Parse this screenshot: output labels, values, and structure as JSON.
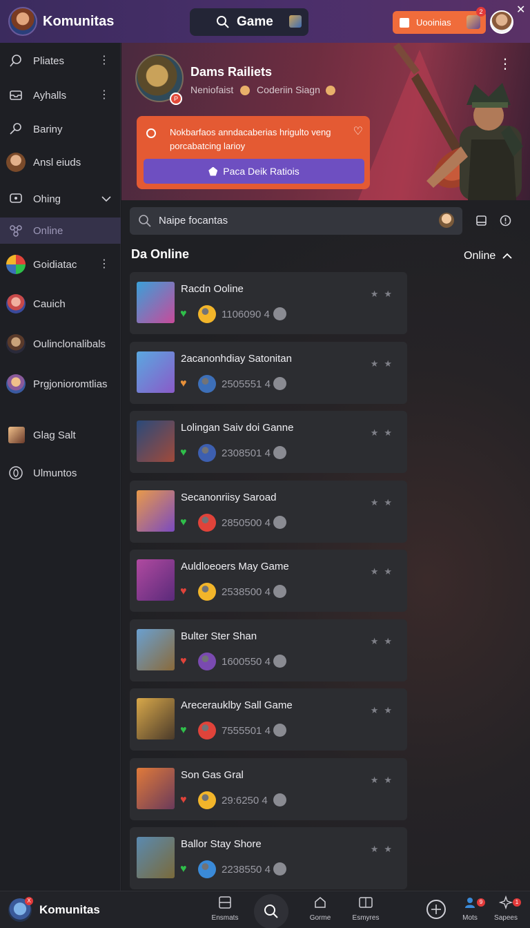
{
  "app": {
    "name": "Komunitas",
    "close_glyph": "✕"
  },
  "topbar": {
    "search_label": "Game",
    "cta_label": "Uooinias",
    "cta_badge": "2"
  },
  "sidebar": {
    "items": [
      {
        "label": "Pliates",
        "icon": "search-icon",
        "trailing": "dots"
      },
      {
        "label": "Ayhalls",
        "icon": "inbox-icon",
        "trailing": "dots"
      },
      {
        "label": "Bariny",
        "icon": "key-icon",
        "trailing": ""
      },
      {
        "label": "Ansl eiuds",
        "icon": "user-avatar",
        "trailing": ""
      },
      {
        "label": "Ohing",
        "icon": "chat-icon",
        "trailing": "chevron"
      },
      {
        "label": "Online",
        "icon": "network-icon",
        "trailing": "",
        "active": true
      },
      {
        "label": "Goidiatac",
        "icon": "colorful-avatar",
        "trailing": "dots"
      },
      {
        "label": "Cauich",
        "icon": "game-avatar",
        "trailing": ""
      },
      {
        "label": "Oulinclonalibals",
        "icon": "game-avatar",
        "trailing": ""
      },
      {
        "label": "Prgjonioromtlias",
        "icon": "game-avatar",
        "trailing": ""
      },
      {
        "label": "Glag Salt",
        "icon": "game-thumb",
        "trailing": ""
      },
      {
        "label": "Ulmuntos",
        "icon": "circle-icon",
        "trailing": ""
      }
    ]
  },
  "banner": {
    "title": "Dams Railiets",
    "subtitle_a": "Neniofaist",
    "subtitle_b": "Coderiin Siagn",
    "avatar_badge": "P",
    "alert_text": "Nokbarfaos anndacaberias hrigulto veng porcabatcing larioy",
    "alert_button": "Paca Deik Ratiois"
  },
  "filter": {
    "placeholder": "Naipe focantas"
  },
  "section": {
    "title": "Da Online",
    "toggle_label": "Online"
  },
  "games": [
    {
      "title": "Racdn Ooline",
      "count": "1106090 4",
      "heart": "#2fbf4a",
      "coin": "#f2b52a",
      "thumb": [
        "#3aa0d8",
        "#c84a9a"
      ]
    },
    {
      "title": "2acanonhdiay Satonitan",
      "count": "2505551 4",
      "heart": "#e8913a",
      "coin": "#3d6fb8",
      "thumb": [
        "#5aa8e0",
        "#8a5ac8"
      ]
    },
    {
      "title": "Lolingan Saiv doi Ganne",
      "count": "2308501 4",
      "heart": "#2fbf4a",
      "coin": "#3d5fb0",
      "thumb": [
        "#2a4a7a",
        "#a04a3a"
      ]
    },
    {
      "title": "Secanonriisy Saroad",
      "count": "2850500 4",
      "heart": "#2fbf4a",
      "coin": "#e0433a",
      "thumb": [
        "#e89a4a",
        "#7a4ac0"
      ]
    },
    {
      "title": "Auldloeoers May Game",
      "count": "2538500 4",
      "heart": "#e0433a",
      "coin": "#f2b52a",
      "thumb": [
        "#b04aa0",
        "#5a2a7a"
      ]
    },
    {
      "title": "Bulter Ster Shan",
      "count": "1600550 4",
      "heart": "#e0433a",
      "coin": "#7a4ab0",
      "thumb": [
        "#6aa0d0",
        "#8a6a3a"
      ]
    },
    {
      "title": "Arecerauklby Sall Game",
      "count": "7555501 4",
      "heart": "#2fbf4a",
      "coin": "#e0433a",
      "thumb": [
        "#d8a84a",
        "#4a3a2a"
      ]
    },
    {
      "title": "Son Gas Gral",
      "count": "29:6250 4",
      "heart": "#e0433a",
      "coin": "#f2b52a",
      "thumb": [
        "#e07a3a",
        "#6a3a5a"
      ]
    },
    {
      "title": "Ballor Stay Shore",
      "count": "2238550 4",
      "heart": "#2fbf4a",
      "coin": "#3a8ad8",
      "thumb": [
        "#5a8ab0",
        "#7a6a3a"
      ]
    }
  ],
  "bottombar": {
    "brand": "Komunitas",
    "brand_badge": "X",
    "items": [
      {
        "label": "Ensmats",
        "icon": "grid-icon"
      },
      {
        "label": "Gorme",
        "icon": "home-icon"
      },
      {
        "label": "Esmyres",
        "icon": "card-icon"
      },
      {
        "label": "Mots",
        "icon": "users-icon",
        "badge": "9"
      },
      {
        "label": "Sapees",
        "icon": "sparkle-icon",
        "badge": "1"
      }
    ]
  },
  "colors": {
    "accent_orange": "#f06c3b",
    "accent_purple": "#6e4fc1",
    "topbar": "#4a2f6b"
  }
}
